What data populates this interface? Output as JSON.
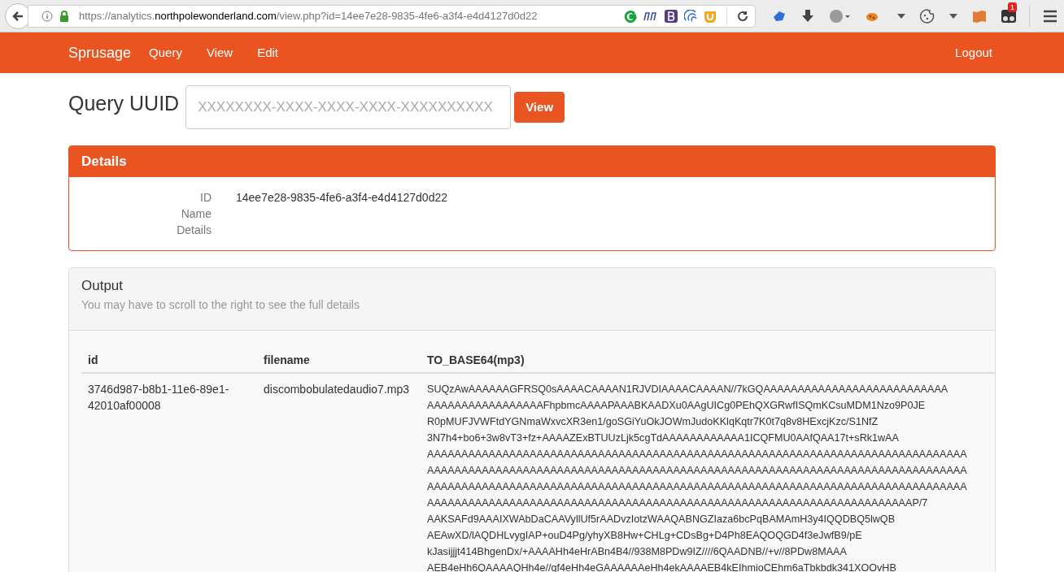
{
  "browser": {
    "url": "https://analytics.**northpolewonderland.com**/view.php?id=14ee7e28-9835-4fe6-a3f4-e4d4127d0d22",
    "notification_count": "1"
  },
  "navbar": {
    "brand": "Sprusage",
    "links": [
      "Query",
      "View",
      "Edit"
    ],
    "logout": "Logout"
  },
  "query": {
    "label": "Query UUID",
    "placeholder": "XXXXXXXX-XXXX-XXXX-XXXX-XXXXXXXXXX",
    "button": "View"
  },
  "details": {
    "title": "Details",
    "fields": [
      {
        "label": "ID",
        "value": "14ee7e28-9835-4fe6-a3f4-e4d4127d0d22"
      },
      {
        "label": "Name"
      },
      {
        "label": "Details"
      }
    ]
  },
  "output": {
    "title": "Output",
    "subtitle": "You may have to scroll to the right to see the full details",
    "table": {
      "columns": [
        "id",
        "filename",
        "TO_BASE64(mp3)"
      ],
      "rows": [
        {
          "id": "3746d987-b8b1-11e6-89e1-42010af00008",
          "filename": "discombobulatedaudio7.mp3",
          "base64_lines": [
            "SUQzAwAAAAAAGFRSQ0sAAAACAAAAN1RJVDIAAAACAAAAN//7kGQAAAAAAAAAAAAAAAAAAAAAAAAAAA",
            "AAAAAAAAAAAAAAAAAFhpbmcAAAAPAAABKAADXu0AAgUICg0PEhQXGRwfISQmKCsuMDM1Nzo9P0JE",
            "R0pMUFJVWFtdYGNmaWxvcXR3en1/goSGiYuOkJOWmJudoKKlqKqtr7K0t7q8v8HExcjKzc/S1NfZ",
            "3N7h4+bo6+3w8vT3+fz+AAAAZExBTUUzLjk5cgTdAAAAAAAAAAAA1ICQFMU0AAfQAA17t+sRk1wAA",
            "AAAAAAAAAAAAAAAAAAAAAAAAAAAAAAAAAAAAAAAAAAAAAAAAAAAAAAAAAAAAAAAAAAAAAAAAAAAAAAA",
            "AAAAAAAAAAAAAAAAAAAAAAAAAAAAAAAAAAAAAAAAAAAAAAAAAAAAAAAAAAAAAAAAAAAAAAAAAAAAAAA",
            "AAAAAAAAAAAAAAAAAAAAAAAAAAAAAAAAAAAAAAAAAAAAAAAAAAAAAAAAAAAAAAAAAAAAAAAAAAAAAAA",
            "AAAAAAAAAAAAAAAAAAAAAAAAAAAAAAAAAAAAAAAAAAAAAAAAAAAAAAAAAAAAAAAAAAAAAAAP/7",
            "AAKSAFd9AAAIXWAbDaCAAVyllUf5rAADvzIotzWAAQABNGZIaza6bcPqBAMAmH3y4IQQDBQ5lwQB",
            "AEAwXD/lAQDHLvygIAP+ouD4Pg/yhyXB8Hw+CHLg+CDsBg+D4Ph8EAQOQGD4f3eJwfB9/pE",
            "kJasijjjt414BhgenDx/+AAAAHh4eHrABn4B4//938M8PDw9IZ////6QAADNB//+v//8PDw8MAAA",
            "AEB4eHh6QAAAAQHh4e//gf4eHh4eGAAAAAAeHh4ekAAAAEB4kEIhmioCEhm6aTbkbdk341XOOvHB"
          ]
        }
      ]
    }
  }
}
